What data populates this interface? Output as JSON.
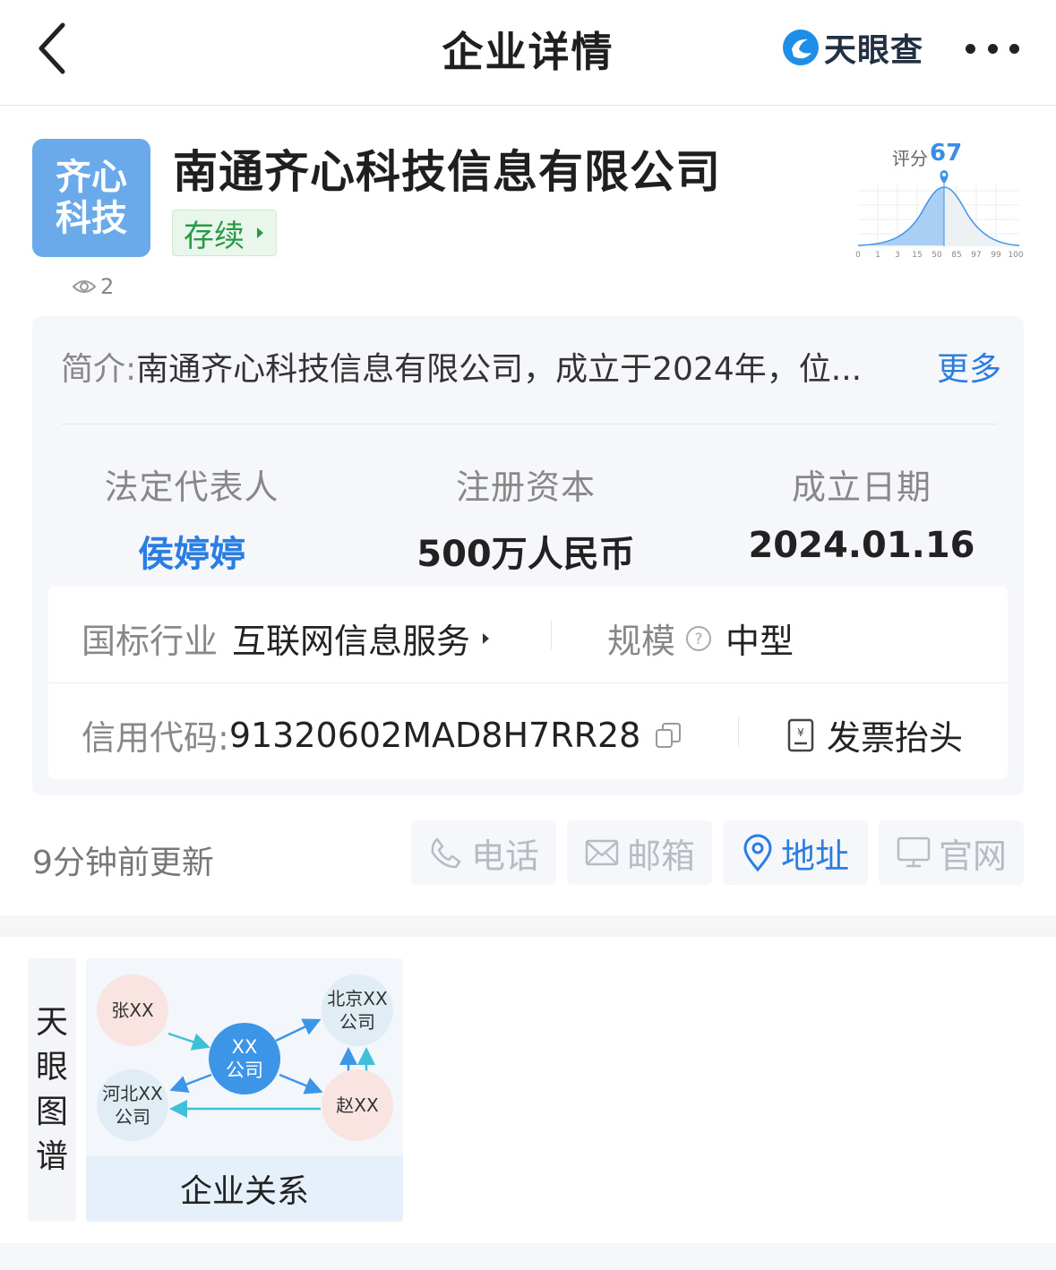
{
  "nav": {
    "title": "企业详情",
    "brand": "天眼查",
    "back_icon": "chevron-left-icon",
    "more_icon": "more-dots-icon"
  },
  "company": {
    "logo_line1": "齐心",
    "logo_line2": "科技",
    "name": "南通齐心科技信息有限公司",
    "status": "存续",
    "views": "2"
  },
  "score": {
    "label": "评分",
    "value": "67",
    "ticks": [
      "0",
      "1",
      "3",
      "15",
      "50",
      "85",
      "97",
      "99",
      "100"
    ]
  },
  "intro": {
    "label": "简介:",
    "text": "南通齐心科技信息有限公司，成立于2024年，位...",
    "more": "更多"
  },
  "stats": {
    "legal_rep_label": "法定代表人",
    "legal_rep_value": "侯婷婷",
    "capital_label": "注册资本",
    "capital_value": "500万人民币",
    "founded_label": "成立日期",
    "founded_value": "2024.01.16"
  },
  "details": {
    "industry_label": "国标行业",
    "industry_value": "互联网信息服务",
    "scale_label": "规模",
    "scale_value": "中型",
    "credit_label": "信用代码: ",
    "credit_value": "91320602MAD8H7RR28",
    "invoice_label": "发票抬头"
  },
  "updated": "9分钟前更新",
  "actions": {
    "phone": "电话",
    "email": "邮箱",
    "address": "地址",
    "website": "官网"
  },
  "graph": {
    "tag_chars": [
      "天",
      "眼",
      "图",
      "谱"
    ],
    "caption": "企业关系",
    "node_zhang": "张XX",
    "node_center_l1": "XX",
    "node_center_l2": "公司",
    "node_beijing_l1": "北京XX",
    "node_beijing_l2": "公司",
    "node_hebei_l1": "河北XX",
    "node_hebei_l2": "公司",
    "node_zhao": "赵XX"
  },
  "colors": {
    "accent": "#2a7de1",
    "status_green": "#2b9a47",
    "logo_bg": "#6aaaea"
  }
}
